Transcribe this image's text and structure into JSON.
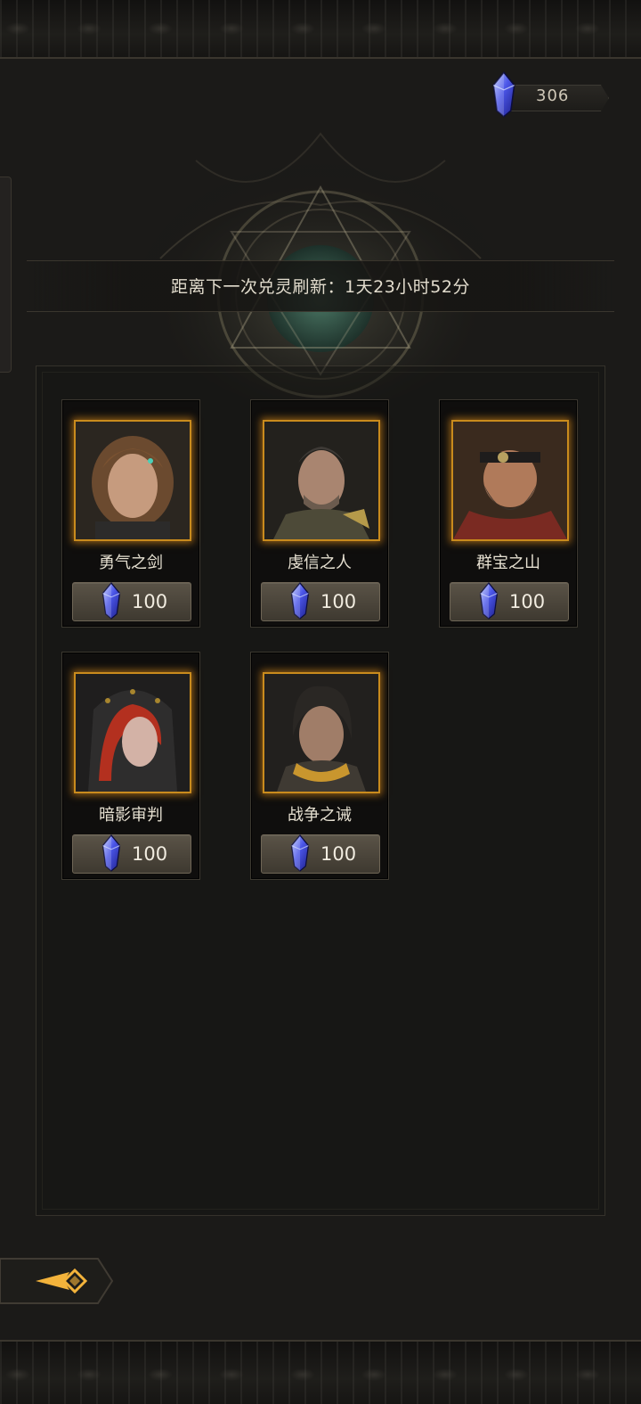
{
  "currency": {
    "icon": "blue-crystal-icon",
    "amount": "306"
  },
  "refresh": {
    "text": "距离下一次兑灵刷新：1天23小时52分"
  },
  "cards": [
    {
      "name": "勇气之剑",
      "price": "100",
      "portrait": "young-woman-portrait",
      "price_icon": "blue-crystal-icon"
    },
    {
      "name": "虔信之人",
      "price": "100",
      "portrait": "armored-man-portrait",
      "price_icon": "blue-crystal-icon"
    },
    {
      "name": "群宝之山",
      "price": "100",
      "portrait": "bearded-dwarf-portrait",
      "price_icon": "blue-crystal-icon"
    },
    {
      "name": "暗影审判",
      "price": "100",
      "portrait": "hooded-redhead-portrait",
      "price_icon": "blue-crystal-icon"
    },
    {
      "name": "战争之诫",
      "price": "100",
      "portrait": "dark-haired-warrior-portrait",
      "price_icon": "blue-crystal-icon"
    }
  ],
  "nav": {
    "back_icon": "back-arrow-icon"
  },
  "colors": {
    "gold_frame": "#c98b1d",
    "crystal": "#3b49d8",
    "background": "#1b1a18"
  }
}
